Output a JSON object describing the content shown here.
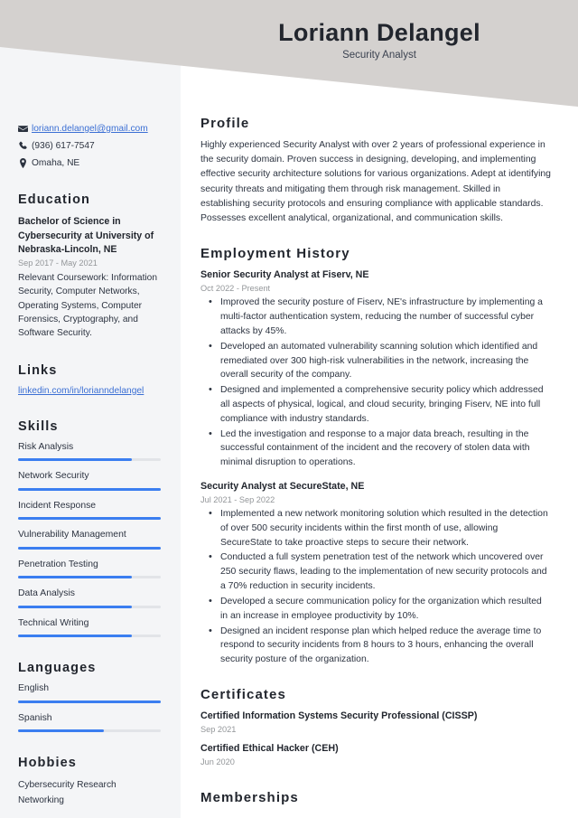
{
  "header": {
    "name": "Loriann Delangel",
    "job_title": "Security Analyst",
    "band_color": "#d4d1cf"
  },
  "theme": {
    "accent": "#3b7ef0",
    "link": "#3b6fd4",
    "sidebar_bg": "#f4f5f7",
    "text": "#2c3340",
    "muted": "#939699"
  },
  "sidebar": {
    "contact": [
      {
        "icon": "envelope-icon",
        "value": "loriann.delangel@gmail.com",
        "is_link": true
      },
      {
        "icon": "phone-icon",
        "value": "(936) 617-7547",
        "is_link": false
      },
      {
        "icon": "location-pin-icon",
        "value": "Omaha, NE",
        "is_link": false
      }
    ],
    "education": {
      "heading": "Education",
      "degree": "Bachelor of Science in Cybersecurity at University of Nebraska-Lincoln, NE",
      "date": "Sep 2017 - May 2021",
      "description": "Relevant Coursework: Information Security, Computer Networks, Operating Systems, Computer Forensics, Cryptography, and Software Security."
    },
    "links": {
      "heading": "Links",
      "items": [
        {
          "label": "linkedin.com/in/lorianndelangel"
        }
      ]
    },
    "skills": {
      "heading": "Skills",
      "items": [
        {
          "label": "Risk Analysis",
          "level": 80
        },
        {
          "label": "Network Security",
          "level": 100
        },
        {
          "label": "Incident Response",
          "level": 100
        },
        {
          "label": "Vulnerability Management",
          "level": 100
        },
        {
          "label": "Penetration Testing",
          "level": 80
        },
        {
          "label": "Data Analysis",
          "level": 80
        },
        {
          "label": "Technical Writing",
          "level": 80
        }
      ]
    },
    "languages": {
      "heading": "Languages",
      "items": [
        {
          "label": "English",
          "level": 100
        },
        {
          "label": "Spanish",
          "level": 60
        }
      ]
    },
    "hobbies": {
      "heading": "Hobbies",
      "items": [
        {
          "label": "Cybersecurity Research"
        },
        {
          "label": "Networking"
        }
      ]
    }
  },
  "main": {
    "profile": {
      "heading": "Profile",
      "text": "Highly experienced Security Analyst with over 2 years of professional experience in the security domain. Proven success in designing, developing, and implementing effective security architecture solutions for various organizations. Adept at identifying security threats and mitigating them through risk management. Skilled in establishing security protocols and ensuring compliance with applicable standards. Possesses excellent analytical, organizational, and communication skills."
    },
    "employment": {
      "heading": "Employment History",
      "jobs": [
        {
          "title": "Senior Security Analyst at Fiserv, NE",
          "date": "Oct 2022 - Present",
          "bullets": [
            "Improved the security posture of Fiserv, NE's infrastructure by implementing a multi-factor authentication system, reducing the number of successful cyber attacks by 45%.",
            "Developed an automated vulnerability scanning solution which identified and remediated over 300 high-risk vulnerabilities in the network, increasing the overall security of the company.",
            "Designed and implemented a comprehensive security policy which addressed all aspects of physical, logical, and cloud security, bringing Fiserv, NE into full compliance with industry standards.",
            "Led the investigation and response to a major data breach, resulting in the successful containment of the incident and the recovery of stolen data with minimal disruption to operations."
          ]
        },
        {
          "title": "Security Analyst at SecureState, NE",
          "date": "Jul 2021 - Sep 2022",
          "bullets": [
            "Implemented a new network monitoring solution which resulted in the detection of over 500 security incidents within the first month of use, allowing SecureState to take proactive steps to secure their network.",
            "Conducted a full system penetration test of the network which uncovered over 250 security flaws, leading to the implementation of new security protocols and a 70% reduction in security incidents.",
            "Developed a secure communication policy for the organization which resulted in an increase in employee productivity by 10%.",
            "Designed an incident response plan which helped reduce the average time to respond to security incidents from 8 hours to 3 hours, enhancing the overall security posture of the organization."
          ]
        }
      ]
    },
    "certificates": {
      "heading": "Certificates",
      "items": [
        {
          "name": "Certified Information Systems Security Professional (CISSP)",
          "date": "Sep 2021"
        },
        {
          "name": "Certified Ethical Hacker (CEH)",
          "date": "Jun 2020"
        }
      ]
    },
    "memberships": {
      "heading": "Memberships"
    }
  }
}
